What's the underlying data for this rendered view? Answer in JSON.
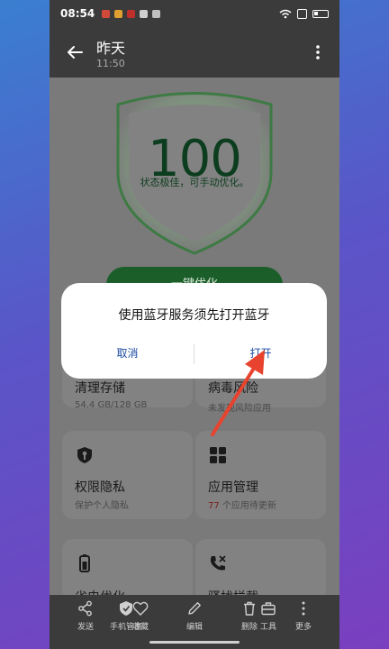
{
  "statusbar": {
    "time": "08:54"
  },
  "appbar": {
    "title": "昨天",
    "subtitle": "11:50"
  },
  "score": {
    "value": "100",
    "status": "状态极佳，可手动优化。"
  },
  "optimize_button": "一键优化",
  "cards": {
    "storage": {
      "title": "清理存储",
      "sub": "54.4 GB/128 GB"
    },
    "virus": {
      "title": "病毒风险",
      "sub": "未发现风险应用"
    },
    "privacy": {
      "title": "权限隐私",
      "sub": "保护个人隐私"
    },
    "apps": {
      "title": "应用管理",
      "sub_count": "77",
      "sub_text": " 个应用待更新"
    },
    "battery": {
      "title": "省电优化"
    },
    "call": {
      "title": "骚扰拦截"
    }
  },
  "dialog": {
    "message": "使用蓝牙服务须先打开蓝牙",
    "cancel": "取消",
    "open": "打开"
  },
  "bottombar": {
    "share": "发送",
    "phone_manager": "手机管家",
    "favorite": "收藏",
    "edit": "编辑",
    "delete": "删除",
    "tools": "工具",
    "more": "更多"
  },
  "colors": {
    "dialog_button": "#1a4aa3",
    "shield_green": "#1b5e2a",
    "arrow": "#e8432e"
  }
}
